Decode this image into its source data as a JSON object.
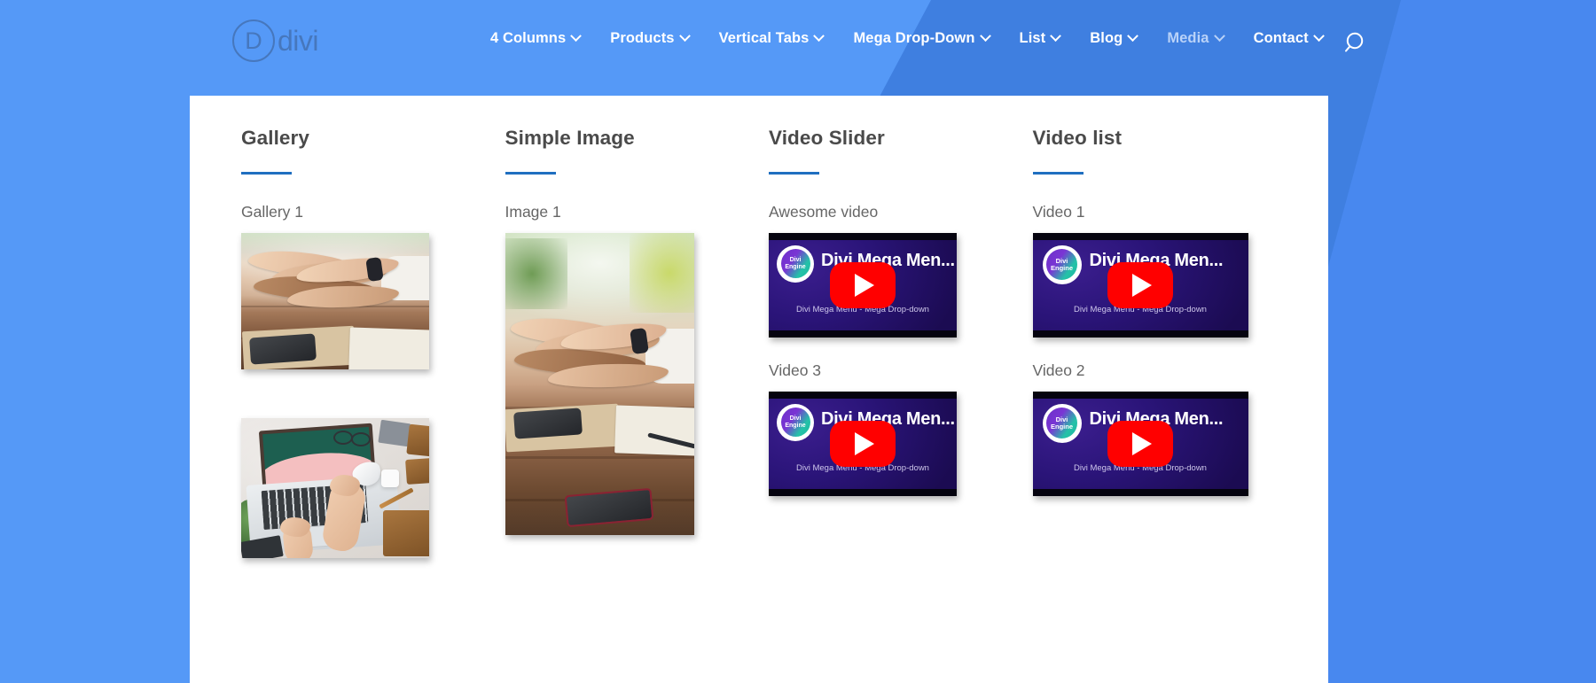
{
  "header": {
    "logo": {
      "mark": "D",
      "word": "divi",
      "icon": "divi-logo-icon"
    },
    "nav_items": [
      {
        "label": "4 Columns",
        "has_caret": true,
        "dim": false
      },
      {
        "label": "Products",
        "has_caret": true,
        "dim": false
      },
      {
        "label": "Vertical Tabs",
        "has_caret": true,
        "dim": false
      },
      {
        "label": "Mega Drop-Down",
        "has_caret": true,
        "dim": false
      },
      {
        "label": "List",
        "has_caret": true,
        "dim": false
      },
      {
        "label": "Blog",
        "has_caret": true,
        "dim": false
      },
      {
        "label": "Media",
        "has_caret": true,
        "dim": true
      },
      {
        "label": "Contact",
        "has_caret": true,
        "dim": false
      }
    ],
    "search_icon": "search-icon"
  },
  "colors": {
    "background_light": "#5599f7",
    "background_dark": "#3f7fe0",
    "panel": "#ffffff",
    "accent_rule": "#1f6fc0",
    "heading_text": "#4a4a4a",
    "label_text": "#666666",
    "play_button": "#ff0000",
    "video_background": "#2a1478"
  },
  "columns": [
    {
      "title": "Gallery",
      "items": [
        {
          "label": "Gallery 1",
          "media": "photo-hands"
        },
        {
          "label": "",
          "media": "photo-desk"
        }
      ]
    },
    {
      "title": "Simple Image",
      "items": [
        {
          "label": "Image 1",
          "media": "photo-hands-tall"
        }
      ]
    },
    {
      "title": "Video Slider",
      "items": [
        {
          "label": "Awesome video",
          "media": "video"
        },
        {
          "label": "Video 3",
          "media": "video"
        }
      ]
    },
    {
      "title": "Video list",
      "items": [
        {
          "label": "Video 1",
          "media": "video"
        },
        {
          "label": "Video 2",
          "media": "video"
        }
      ]
    }
  ],
  "video": {
    "title": "Divi Mega Men...",
    "subtitle": "Divi Mega Menu - Mega Drop-down",
    "logo_line1": "Divi",
    "logo_line2": "Engine",
    "play_icon": "play-icon"
  }
}
